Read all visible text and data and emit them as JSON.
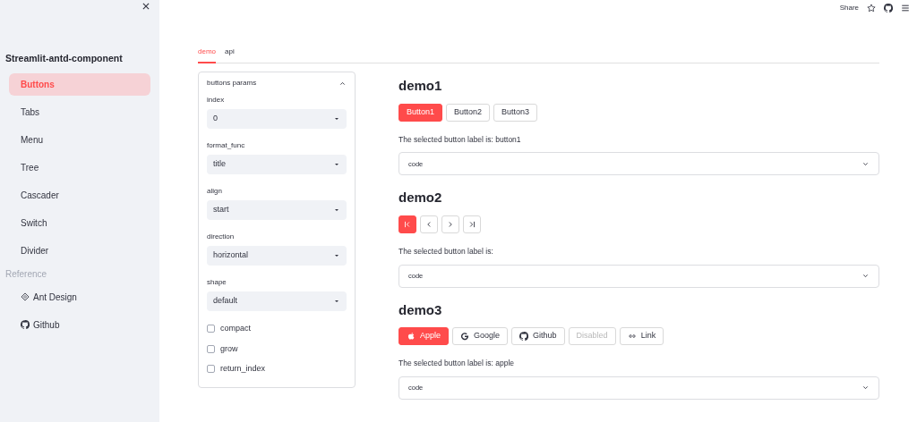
{
  "sidebar": {
    "title": "Streamlit-antd-component",
    "items": [
      {
        "label": "Buttons",
        "selected": true
      },
      {
        "label": "Tabs",
        "selected": false
      },
      {
        "label": "Menu",
        "selected": false
      },
      {
        "label": "Tree",
        "selected": false
      },
      {
        "label": "Cascader",
        "selected": false
      },
      {
        "label": "Switch",
        "selected": false
      },
      {
        "label": "Divider",
        "selected": false
      }
    ],
    "section": "Reference",
    "links": [
      {
        "label": "Ant Design"
      },
      {
        "label": "Github"
      }
    ]
  },
  "header": {
    "share": "Share"
  },
  "tabs": [
    {
      "label": "demo",
      "selected": true
    },
    {
      "label": "api",
      "selected": false
    }
  ],
  "params": {
    "title": "buttons params",
    "expanded": true,
    "selects": [
      {
        "label": "index",
        "value": "0"
      },
      {
        "label": "format_func",
        "value": "title"
      },
      {
        "label": "align",
        "value": "start"
      },
      {
        "label": "direction",
        "value": "horizontal"
      },
      {
        "label": "shape",
        "value": "default"
      }
    ],
    "checkboxes": [
      {
        "label": "compact",
        "checked": false
      },
      {
        "label": "grow",
        "checked": false
      },
      {
        "label": "return_index",
        "checked": false
      }
    ]
  },
  "demos": [
    {
      "title": "demo1",
      "buttons": [
        {
          "label": "Button1",
          "selected": true,
          "disabled": false
        },
        {
          "label": "Button2",
          "selected": false,
          "disabled": false
        },
        {
          "label": "Button3",
          "selected": false,
          "disabled": false
        }
      ],
      "result": "The selected button label is: button1",
      "expander": "code"
    },
    {
      "title": "demo2",
      "buttons": [
        {
          "selected": true,
          "disabled": false
        },
        {
          "selected": false,
          "disabled": false
        },
        {
          "selected": false,
          "disabled": false
        },
        {
          "selected": false,
          "disabled": false
        }
      ],
      "result": "The selected button label is:",
      "expander": "code"
    },
    {
      "title": "demo3",
      "buttons": [
        {
          "label": "Apple",
          "selected": true,
          "disabled": false
        },
        {
          "label": "Google",
          "selected": false,
          "disabled": false
        },
        {
          "label": "Github",
          "selected": false,
          "disabled": false
        },
        {
          "label": "Disabled",
          "selected": false,
          "disabled": true
        },
        {
          "label": "Link",
          "selected": false,
          "disabled": false
        }
      ],
      "result": "The selected button label is: apple",
      "expander": "code"
    }
  ]
}
